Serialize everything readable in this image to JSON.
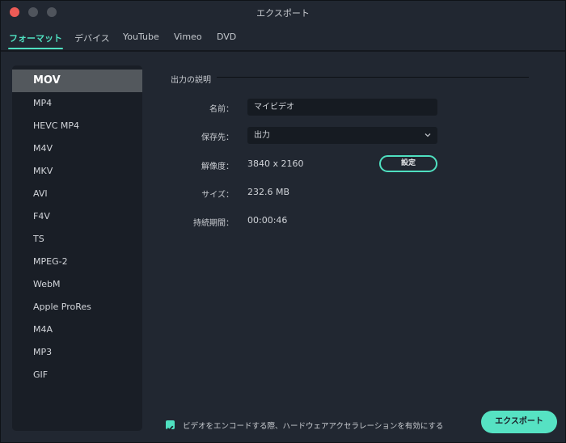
{
  "window": {
    "title": "エクスポート"
  },
  "tabs": [
    {
      "label": "フォーマット",
      "active": true
    },
    {
      "label": "デバイス",
      "active": false
    },
    {
      "label": "YouTube",
      "active": false
    },
    {
      "label": "Vimeo",
      "active": false
    },
    {
      "label": "DVD",
      "active": false
    }
  ],
  "formats": {
    "selected": "MOV",
    "items": [
      "MOV",
      "MP4",
      "HEVC MP4",
      "M4V",
      "MKV",
      "AVI",
      "F4V",
      "TS",
      "MPEG-2",
      "WebM",
      "Apple ProRes",
      "M4A",
      "MP3",
      "GIF"
    ]
  },
  "output": {
    "section_title": "出力の説明",
    "name_label": "名前：",
    "name_value": "マイビデオ",
    "save_label": "保存先：",
    "save_value": "出力",
    "resolution_label": "解像度：",
    "resolution_value": "3840 x 2160",
    "settings_button": "設定",
    "size_label": "サイズ：",
    "size_value": "232.6 MB",
    "duration_label": "持続期間：",
    "duration_value": "00:00:46"
  },
  "footer": {
    "hw_accel_label": "ビデオをエンコードする際、ハードウェアアクセラレーションを有効にする",
    "hw_accel_checked": true,
    "export_button": "エクスポート"
  },
  "colors": {
    "accent": "#4fe0c0",
    "close": "#ec5b56",
    "background": "#212731",
    "list_background": "#191e26",
    "selected_item": "#53585d"
  }
}
